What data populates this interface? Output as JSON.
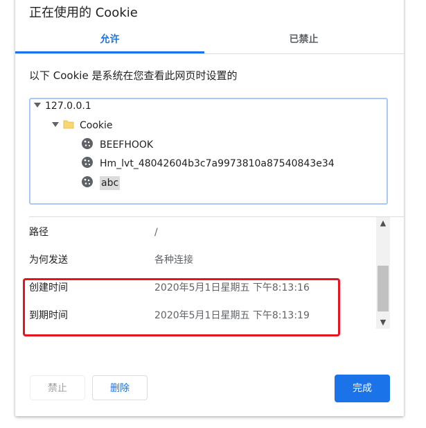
{
  "dialog": {
    "title": "正在使用的 Cookie"
  },
  "tabs": [
    {
      "label": "允许",
      "active": true
    },
    {
      "label": "已禁止",
      "active": false
    }
  ],
  "description": "以下 Cookie 是系统在您查看此网页时设置的",
  "tree": {
    "root": {
      "label": "127.0.0.1",
      "expanded": true,
      "icon": "triangle-expanded-icon"
    },
    "folder": {
      "label": "Cookie",
      "expanded": true,
      "icon": "folder-icon"
    },
    "cookies": [
      {
        "label": "BEEFHOOK",
        "icon": "cookie-icon",
        "selected": false
      },
      {
        "label": "Hm_lvt_48042604b3c7a9973810a87540843e34",
        "icon": "cookie-icon",
        "selected": false
      },
      {
        "label": "abc",
        "icon": "cookie-icon",
        "selected": true
      }
    ]
  },
  "details": [
    {
      "label": "路径",
      "value": "/"
    },
    {
      "label": "为何发送",
      "value": "各种连接"
    },
    {
      "label": "创建时间",
      "value": "2020年5月1日星期五 下午8:13:16"
    },
    {
      "label": "到期时间",
      "value": "2020年5月1日星期五 下午8:13:19"
    }
  ],
  "buttons": {
    "block": "禁止",
    "remove": "删除",
    "done": "完成"
  },
  "colors": {
    "accent": "#1a73e8",
    "highlight_border": "#e8131f",
    "tree_border": "#a8c7fa"
  }
}
